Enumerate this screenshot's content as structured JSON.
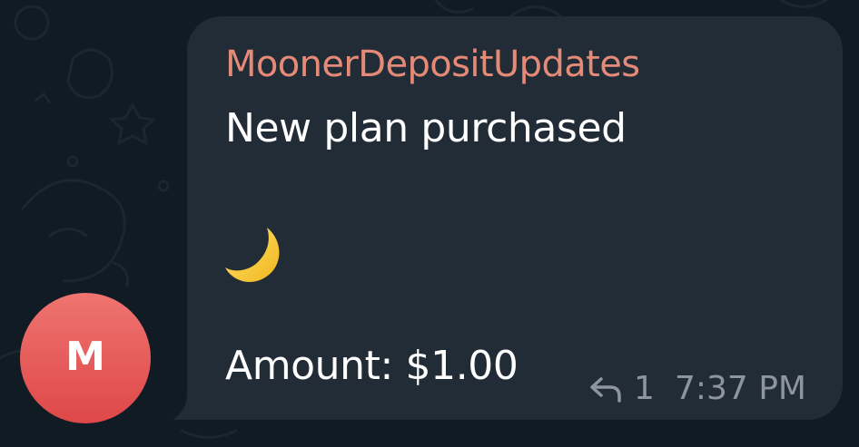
{
  "message": {
    "sender": "MoonerDepositUpdates",
    "line1": "New plan purchased",
    "emoji_icon": "crescent-moon-icon",
    "amount_line": "Amount: $1.00",
    "reply_icon": "reply-arrow-icon",
    "reply_count": "1",
    "time": "7:37 PM"
  },
  "avatar": {
    "initial": "M"
  },
  "colors": {
    "chat_background": "#111b24",
    "bubble": "#222c37",
    "sender_name": "#e58a76",
    "message_text": "#ffffff",
    "meta_text": "#8d969f",
    "avatar_top": "#ef7470",
    "avatar_bottom": "#de4848"
  }
}
